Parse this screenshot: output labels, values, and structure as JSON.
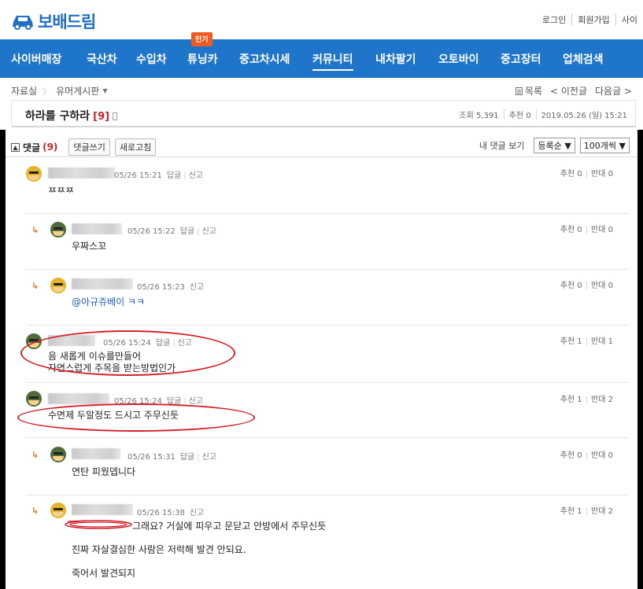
{
  "site": {
    "logo_text": "보배드림"
  },
  "top_links": [
    "로그인",
    "회원가입",
    "사이"
  ],
  "nav": {
    "items": [
      "사이버매장",
      "국산차",
      "수입차",
      "튜닝카",
      "중고차시세",
      "커뮤니티",
      "내차팔기",
      "오토바이",
      "중고장터",
      "업체검색"
    ],
    "active": "커뮤니티",
    "hot_badge": "인기"
  },
  "breadcrumb": {
    "first": "자료실",
    "second": "유머게시판"
  },
  "post_nav": {
    "list": "목록",
    "prev": "< 이전글",
    "next": "다음글 >"
  },
  "post": {
    "title": "하라를 구하라",
    "comment_count_label": "[9]",
    "views_label": "조회 5,391",
    "recommend_label": "추천 0",
    "date": "2019.05.26 (일) 15:21"
  },
  "comment_bar": {
    "title": "댓글",
    "count": "(9)",
    "write_button": "댓글쓰기",
    "refresh_button": "새로고침",
    "my_comments": "내 댓글 보기",
    "sort_option": "등록순 ▼",
    "per_page_option": "100개씩 ▼"
  },
  "comments": [
    {
      "time": "05/26 15:21",
      "reply": "답글",
      "report": "신고",
      "text_lines": [
        "ㅉㅉㅉ"
      ],
      "up": "추천 0",
      "down": "반대 0"
    },
    {
      "time": "05/26 15:22",
      "reply": "답글",
      "report": "신고",
      "text_lines": [
        "우짜스꼬"
      ],
      "up": "추천 0",
      "down": "반대 0"
    },
    {
      "time": "05/26 15:23",
      "report": "신고",
      "text_lines": [
        "@아규쥬베이 ㅋㅋ"
      ],
      "up": "추천 0",
      "down": "반대 0"
    },
    {
      "time": "05/26 15:24",
      "reply": "답글",
      "report": "신고",
      "text_lines": [
        "음 새롭게 이슈를만들어",
        "자연스럽게 주목을 받는방법인가"
      ],
      "up": "추천 1",
      "down": "반대 1"
    },
    {
      "time": "05/26 15:24",
      "reply": "답글",
      "report": "신고",
      "text_lines": [
        "수면제 두알정도 드시고 주무신듯"
      ],
      "up": "추천 1",
      "down": "반대 2"
    },
    {
      "time": "05/26 15:31",
      "reply": "답글",
      "report": "신고",
      "text_lines": [
        "연탄 피웠뎁니다"
      ],
      "up": "추천 0",
      "down": "반대 0"
    },
    {
      "time": "05/26 15:38",
      "report": "신고",
      "text_lines": [
        "그래요? 거실에 피우고 문닫고 안방에서 주무신듯",
        "진짜 자살결심한 사람은 저럭해 발견 안되요.",
        "죽어서 발견되지"
      ],
      "up": "추천 1",
      "down": "반대 2"
    }
  ],
  "colors": {
    "nav_bg": "#1e75c9",
    "accent_red": "#c8282b",
    "annotation_red": "#d3212a",
    "badge_orange": "#f05a23"
  }
}
